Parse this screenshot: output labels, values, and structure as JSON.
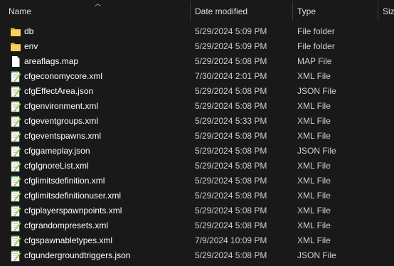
{
  "columns": {
    "name": "Name",
    "date": "Date modified",
    "type": "Type",
    "size": "Size"
  },
  "files": [
    {
      "name": "db",
      "date": "5/29/2024 5:09 PM",
      "type": "File folder",
      "icon": "folder-icon"
    },
    {
      "name": "env",
      "date": "5/29/2024 5:09 PM",
      "type": "File folder",
      "icon": "folder-icon"
    },
    {
      "name": "areaflags.map",
      "date": "5/29/2024 5:08 PM",
      "type": "MAP File",
      "icon": "blank-file-icon"
    },
    {
      "name": "cfgeconomycore.xml",
      "date": "7/30/2024 2:01 PM",
      "type": "XML File",
      "icon": "notepadpp-file-icon"
    },
    {
      "name": "cfgEffectArea.json",
      "date": "5/29/2024 5:08 PM",
      "type": "JSON File",
      "icon": "notepadpp-file-icon"
    },
    {
      "name": "cfgenvironment.xml",
      "date": "5/29/2024 5:08 PM",
      "type": "XML File",
      "icon": "notepadpp-file-icon"
    },
    {
      "name": "cfgeventgroups.xml",
      "date": "5/29/2024 5:33 PM",
      "type": "XML File",
      "icon": "notepadpp-file-icon"
    },
    {
      "name": "cfgeventspawns.xml",
      "date": "5/29/2024 5:08 PM",
      "type": "XML File",
      "icon": "notepadpp-file-icon"
    },
    {
      "name": "cfggameplay.json",
      "date": "5/29/2024 5:08 PM",
      "type": "JSON File",
      "icon": "notepadpp-file-icon"
    },
    {
      "name": "cfgIgnoreList.xml",
      "date": "5/29/2024 5:08 PM",
      "type": "XML File",
      "icon": "notepadpp-file-icon"
    },
    {
      "name": "cfglimitsdefinition.xml",
      "date": "5/29/2024 5:08 PM",
      "type": "XML File",
      "icon": "notepadpp-file-icon"
    },
    {
      "name": "cfglimitsdefinitionuser.xml",
      "date": "5/29/2024 5:08 PM",
      "type": "XML File",
      "icon": "notepadpp-file-icon"
    },
    {
      "name": "cfgplayerspawnpoints.xml",
      "date": "5/29/2024 5:08 PM",
      "type": "XML File",
      "icon": "notepadpp-file-icon"
    },
    {
      "name": "cfgrandompresets.xml",
      "date": "5/29/2024 5:08 PM",
      "type": "XML File",
      "icon": "notepadpp-file-icon"
    },
    {
      "name": "cfgspawnabletypes.xml",
      "date": "7/9/2024 10:09 PM",
      "type": "XML File",
      "icon": "notepadpp-file-icon"
    },
    {
      "name": "cfgundergroundtriggers.json",
      "date": "5/29/2024 5:08 PM",
      "type": "JSON File",
      "icon": "notepadpp-file-icon"
    }
  ],
  "colors": {
    "background": "#191919",
    "folder": "#f2c94c",
    "notepad_green": "#8fd14f"
  }
}
